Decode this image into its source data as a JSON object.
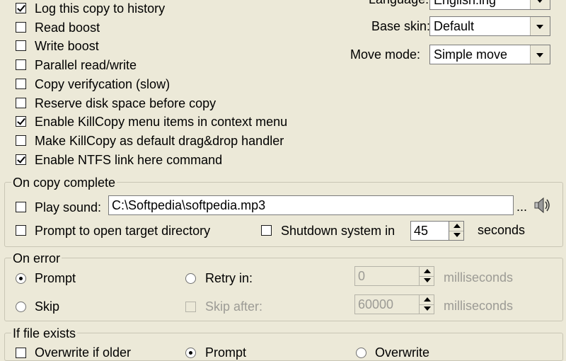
{
  "general": {
    "options": [
      {
        "label": "Log this copy to history",
        "checked": true
      },
      {
        "label": "Read boost",
        "checked": false
      },
      {
        "label": "Write boost",
        "checked": false
      },
      {
        "label": "Parallel read/write",
        "checked": false
      },
      {
        "label": "Copy verifycation (slow)",
        "checked": false
      },
      {
        "label": "Reserve disk space before copy",
        "checked": false
      },
      {
        "label": "Enable KillCopy menu items in context menu",
        "checked": true
      },
      {
        "label": "Make KillCopy as default drag&drop handler",
        "checked": false
      },
      {
        "label": "Enable NTFS link here command",
        "checked": true
      }
    ],
    "language_label": "Language:",
    "language_value": "English.lng",
    "base_skin_label": "Base skin:",
    "base_skin_value": "Default",
    "move_mode_label": "Move mode:",
    "move_mode_value": "Simple move"
  },
  "on_copy_complete": {
    "title": "On copy complete",
    "play_sound_label": "Play sound:",
    "sound_path": "C:\\Softpedia\\softpedia.mp3",
    "browse_label": "...",
    "prompt_open_label": "Prompt to open target directory",
    "shutdown_label": "Shutdown system in",
    "shutdown_value": "45",
    "seconds_label": "seconds"
  },
  "on_error": {
    "title": "On error",
    "prompt_label": "Prompt",
    "skip_label": "Skip",
    "retry_label": "Retry in:",
    "retry_value": "0",
    "retry_unit": "milliseconds",
    "skip_after_label": "Skip after:",
    "skip_after_value": "60000",
    "skip_after_unit": "milliseconds"
  },
  "if_file_exists": {
    "title": "If file exists",
    "overwrite_older_label": "Overwrite if older",
    "prompt_label": "Prompt",
    "overwrite_label": "Overwrite"
  }
}
